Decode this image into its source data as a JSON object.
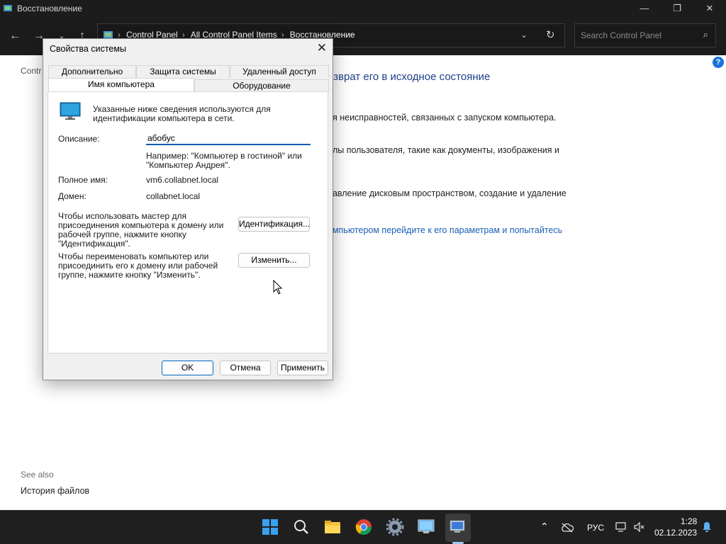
{
  "window": {
    "title": "Восстановление",
    "controls": [
      "minimize-icon",
      "maximize-icon",
      "close-icon"
    ]
  },
  "address": {
    "crumbs": [
      "Control Panel",
      "All Control Panel Items",
      "Восстановление"
    ],
    "search_placeholder": "Search Control Panel"
  },
  "background": {
    "crumb": "Contr",
    "heading": "озврат его в исходное состояние",
    "lines": [
      "ия неисправностей, связанных с запуском компьютера.",
      "йлы пользователя, такие как документы, изображения и",
      "равление дисковым пространством, создание и удаление"
    ],
    "link": "омпьютером перейдите к его параметрам и попытайтесь",
    "see_also": "See also",
    "see_also_item": "История файлов"
  },
  "dialog": {
    "title": "Свойства системы",
    "tabs_back": [
      "Дополнительно",
      "Защита системы",
      "Удаленный доступ"
    ],
    "tabs_front": [
      "Имя компьютера",
      "Оборудование"
    ],
    "active_tab": "Имя компьютера",
    "intro": [
      "Указанные ниже сведения используются для",
      "идентификации компьютера в сети."
    ],
    "description_label": "Описание:",
    "description_value": "абобус",
    "example": [
      "Например: \"Компьютер в гостиной\" или",
      "\"Компьютер Андрея\"."
    ],
    "fullname_label": "Полное имя:",
    "fullname_value": "vm6.collabnet.local",
    "domain_label": "Домен:",
    "domain_value": "collabnet.local",
    "wizard_text": [
      "Чтобы использовать мастер для",
      "присоединения компьютера к домену или",
      "рабочей группе, нажмите кнопку",
      "\"Идентификация\"."
    ],
    "identify_button": "Идентификация...",
    "rename_text": [
      "Чтобы переименовать компьютер или",
      "присоединить его к домену или рабочей",
      "группе, нажмите кнопку \"Изменить\"."
    ],
    "change_button": "Изменить...",
    "ok": "OK",
    "cancel": "Отмена",
    "apply": "Применить"
  },
  "taskbar": {
    "apps": [
      "windows-start-icon",
      "search-icon",
      "file-explorer-icon",
      "chrome-icon",
      "settings-icon",
      "remote-desktop-icon",
      "system-properties-icon"
    ],
    "language": "РУС",
    "time": "1:28",
    "date": "02.12.2023"
  },
  "colors": {
    "chrome_dark": "#1c1c1c",
    "accent": "#0067c0",
    "link": "#1a5fb4",
    "heading": "#1e3f8a"
  }
}
